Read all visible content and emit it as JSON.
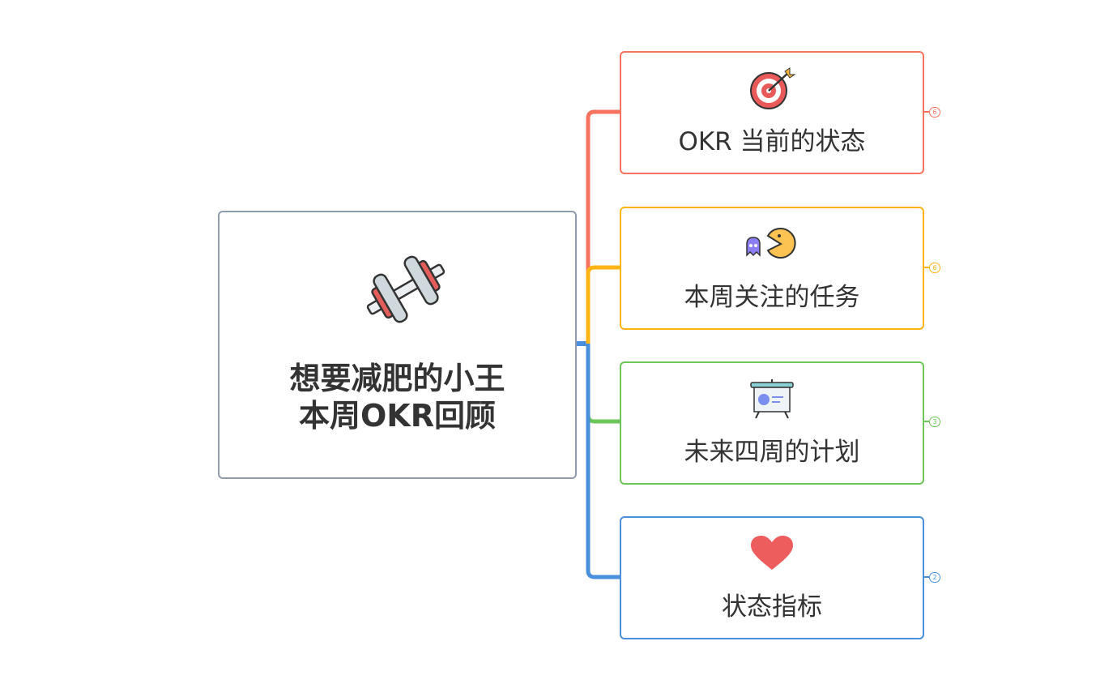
{
  "central": {
    "title_line1": "想要减肥的小王",
    "title_line2": "本周OKR回顾",
    "icon": "dumbbell-icon",
    "border_color": "#8f9aad"
  },
  "branches": [
    {
      "label": "OKR 当前的状态",
      "icon": "target-icon",
      "color": "#f8735f",
      "count": "6"
    },
    {
      "label": "本周关注的任务",
      "icon": "pacman-icon",
      "color": "#fdb515",
      "count": "6"
    },
    {
      "label": "未来四周的计划",
      "icon": "presentation-board-icon",
      "color": "#6cc659",
      "count": "3"
    },
    {
      "label": "状态指标",
      "icon": "heart-icon",
      "color": "#4a8fdc",
      "count": "2"
    }
  ]
}
